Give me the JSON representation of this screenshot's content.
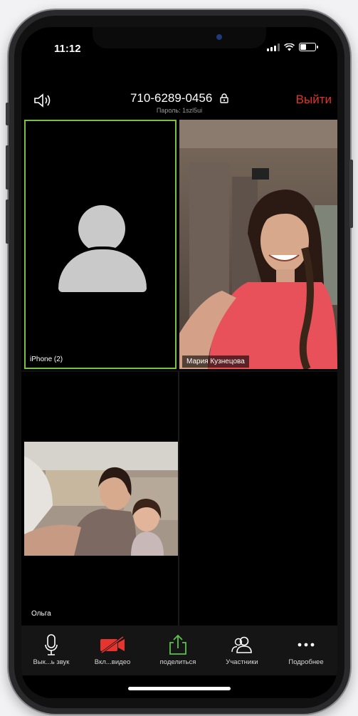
{
  "status_bar": {
    "time": "11:12"
  },
  "meeting": {
    "id": "710-6289-0456",
    "password": "Пароль: 1szl5ui",
    "leave_label": "Выйти"
  },
  "participants": [
    {
      "name": "iPhone (2)",
      "video": "off",
      "active_speaker": true
    },
    {
      "name": "Мария Кузнецова",
      "video": "on"
    },
    {
      "name": "Ольга",
      "video": "on"
    }
  ],
  "toolbar": {
    "items": [
      {
        "label": "Вык...ь звук",
        "icon": "microphone-icon"
      },
      {
        "label": "Вкл...видео",
        "icon": "video-off-icon"
      },
      {
        "label": "поделиться",
        "icon": "share-icon"
      },
      {
        "label": "Участники",
        "icon": "participants-icon"
      },
      {
        "label": "Подробнее",
        "icon": "more-icon"
      }
    ]
  },
  "colors": {
    "active_border": "#7ac142",
    "leave_red": "#e0342b",
    "share_green": "#5cc24a",
    "video_off_red": "#e5352e"
  }
}
